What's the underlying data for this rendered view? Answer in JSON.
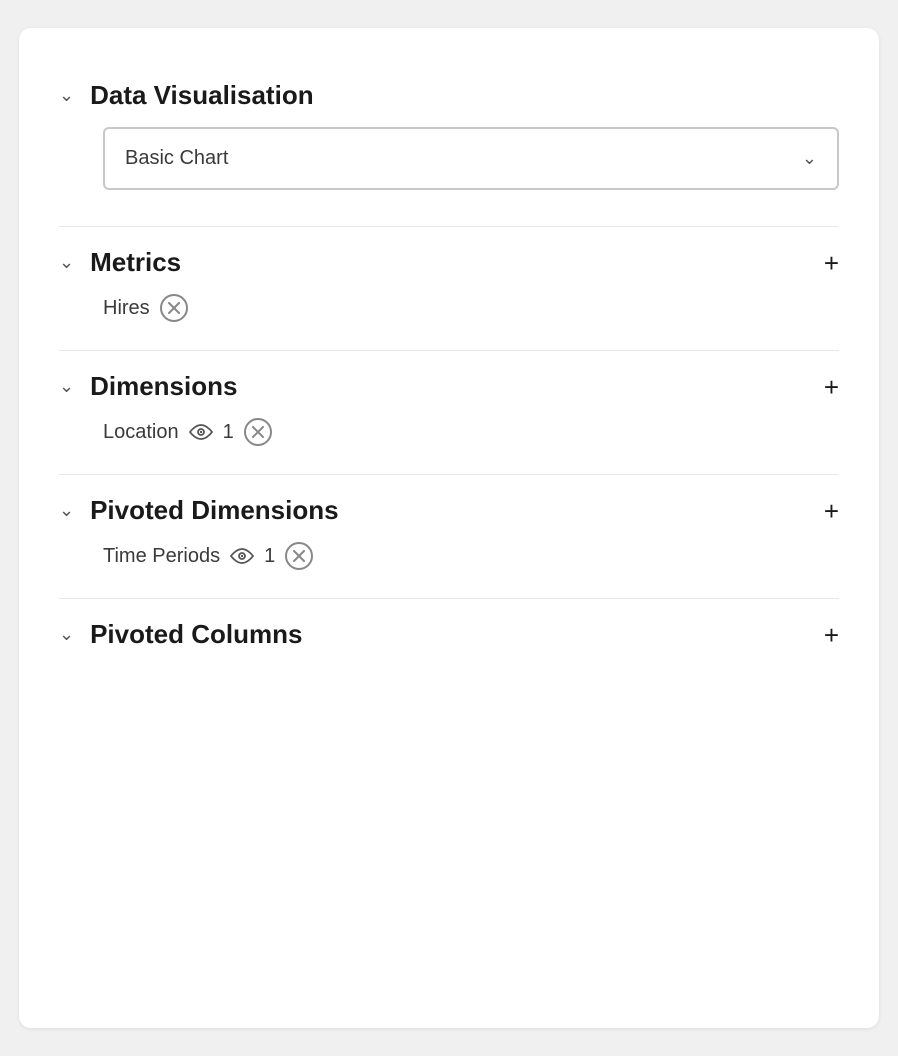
{
  "panel": {
    "sections": [
      {
        "id": "data-visualisation",
        "title": "Data Visualisation",
        "has_add": false,
        "content_type": "dropdown",
        "dropdown": {
          "value": "Basic Chart",
          "placeholder": "Basic Chart"
        }
      },
      {
        "id": "metrics",
        "title": "Metrics",
        "has_add": true,
        "add_label": "+",
        "content_type": "tags",
        "tags": [
          {
            "label": "Hires",
            "has_eye": false,
            "has_count": false
          }
        ]
      },
      {
        "id": "dimensions",
        "title": "Dimensions",
        "has_add": true,
        "add_label": "+",
        "content_type": "tags",
        "tags": [
          {
            "label": "Location",
            "has_eye": true,
            "has_count": true,
            "count": "1"
          }
        ]
      },
      {
        "id": "pivoted-dimensions",
        "title": "Pivoted Dimensions",
        "has_add": true,
        "add_label": "+",
        "content_type": "tags",
        "tags": [
          {
            "label": "Time Periods",
            "has_eye": true,
            "has_count": true,
            "count": "1"
          }
        ]
      },
      {
        "id": "pivoted-columns",
        "title": "Pivoted Columns",
        "has_add": true,
        "add_label": "+",
        "content_type": "empty"
      }
    ]
  }
}
